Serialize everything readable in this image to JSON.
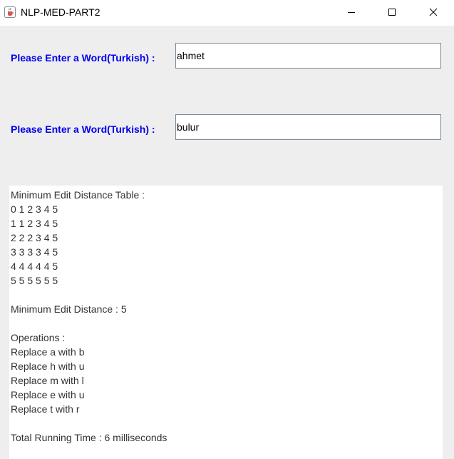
{
  "window": {
    "title": "NLP-MED-PART2"
  },
  "form": {
    "label_1": "Please Enter a Word(Turkish) :",
    "word_1": "ahmet",
    "label_2": "Please Enter a Word(Turkish) :",
    "word_2": "bulur"
  },
  "result": {
    "table_heading": "Minimum Edit Distance Table :",
    "table_rows": [
      "0 1 2 3 4 5",
      "1 1 2 3 4 5",
      "2 2 2 3 4 5",
      "3 3 3 3 4 5",
      "4 4 4 4 4 5",
      "5 5 5 5 5 5"
    ],
    "distance_line": "Minimum Edit Distance : 5",
    "operations_heading": "Operations :",
    "operations": [
      "Replace a with b",
      "Replace h with u",
      "Replace m with l",
      "Replace e with u",
      "Replace t with r"
    ],
    "running_time": "Total Running Time : 6 milliseconds"
  },
  "icons": {
    "app": "java-coffee-cup-icon",
    "minimize": "minimize-icon",
    "maximize": "maximize-icon",
    "close": "close-icon"
  },
  "colors": {
    "label": "#0000ee",
    "panel_background": "#eeeeee",
    "text_area_background": "#ffffff",
    "text": "#333333",
    "field_border": "#7a8a99"
  }
}
